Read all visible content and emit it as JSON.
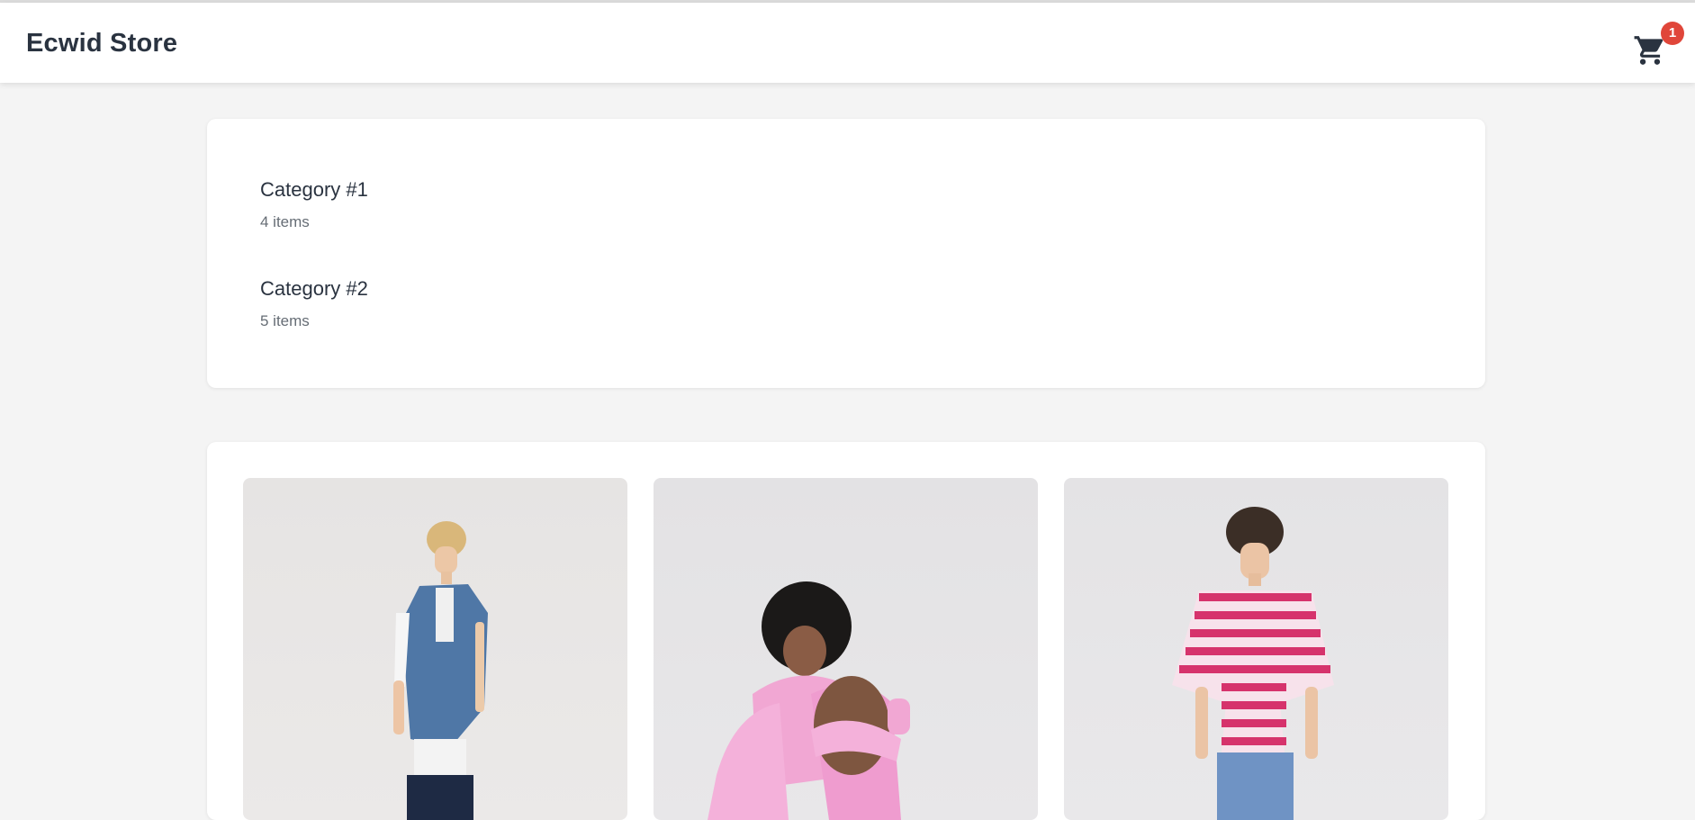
{
  "header": {
    "store_name": "Ecwid Store",
    "cart_count": "1",
    "cart_icon": "shopping-cart-icon"
  },
  "categories": [
    {
      "name": "Category #1",
      "count": "4 items"
    },
    {
      "name": "Category #2",
      "count": "5 items"
    }
  ],
  "products": [
    {
      "image": "model-denim-vest-photo"
    },
    {
      "image": "model-pink-hoodie-photo"
    },
    {
      "image": "model-striped-tee-photo"
    }
  ],
  "colors": {
    "badge": "#e0463a",
    "text": "#2a3340",
    "background": "#f4f4f4"
  }
}
